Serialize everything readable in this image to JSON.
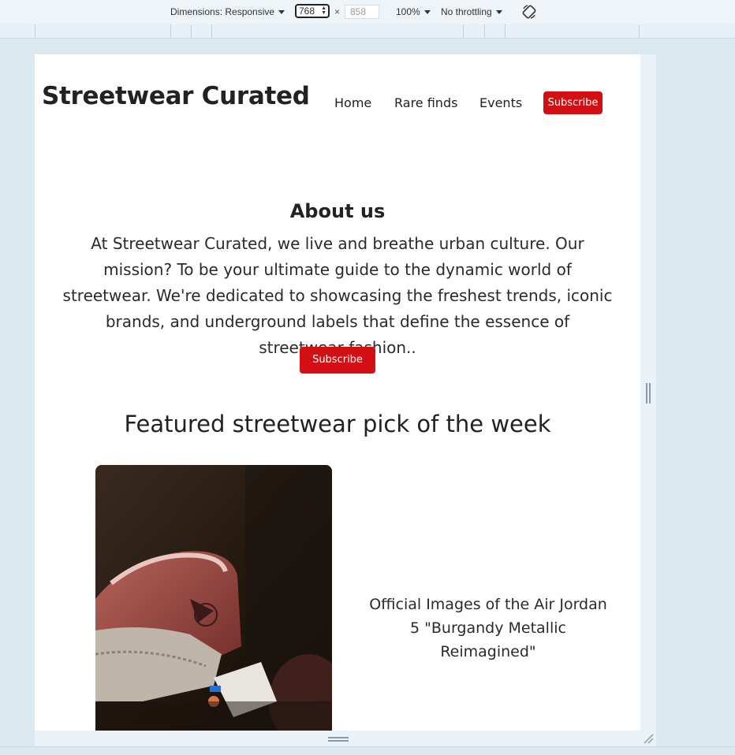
{
  "devtools": {
    "dimensions_label": "Dimensions: Responsive",
    "width_value": "768",
    "height_placeholder": "858",
    "zoom": "100%",
    "throttling": "No throttling"
  },
  "site": {
    "brand": "Streetwear Curated",
    "nav": [
      "Home",
      "Rare finds",
      "Events"
    ],
    "nav_subscribe": "Subscribe"
  },
  "about": {
    "title": "About us",
    "text": "At Streetwear Curated, we live and breathe urban culture. Our mission? To be your ultimate guide to the dynamic world of streetwear. We're dedicated to showcasing the freshest trends, iconic brands, and underground labels that define the essence of streetwear fashion..",
    "subscribe": "Subscribe"
  },
  "featured": {
    "title": "Featured streetwear pick of the week",
    "caption": "Official Images of the Air Jordan 5 \"Burgandy Metallic Reimagined\""
  },
  "colors": {
    "accent": "#d40f14",
    "devtools_bg": "#dce8f0"
  }
}
